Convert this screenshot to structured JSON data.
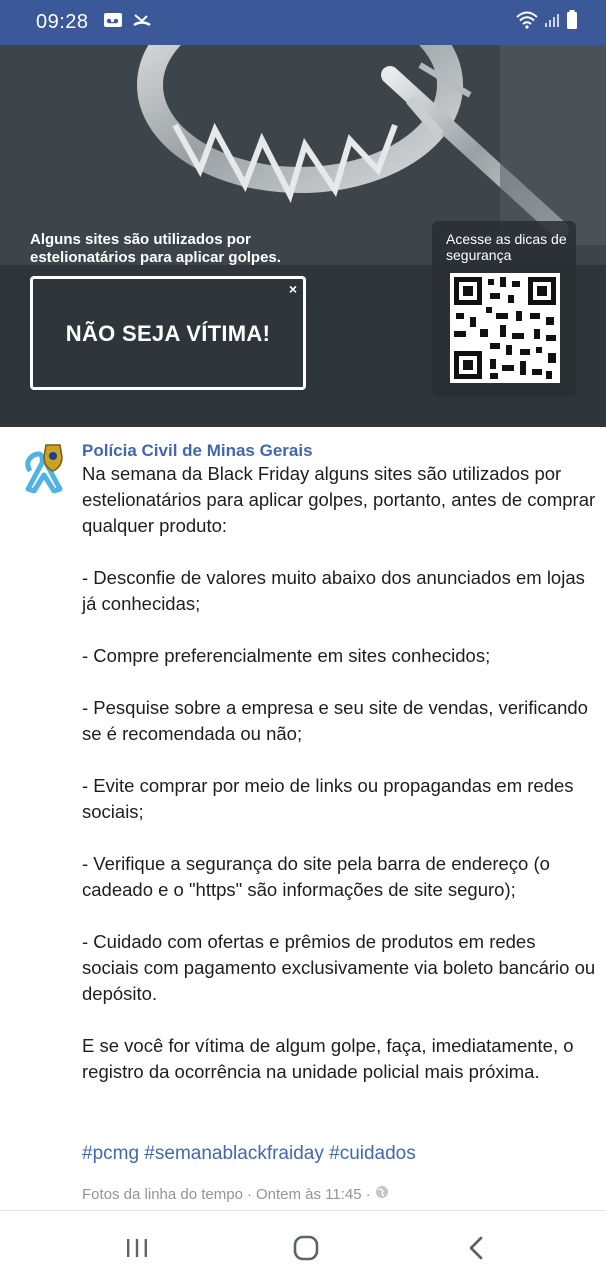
{
  "status_bar": {
    "time": "09:28",
    "icons": [
      "voicemail-icon",
      "missed-call-icon",
      "wifi-icon",
      "signal-icon",
      "battery-icon"
    ],
    "background": "#3b5998"
  },
  "banner": {
    "caption": "Alguns sites são utilizados por estelionatários para aplicar golpes.",
    "cta": "NÃO SEJA VÍTIMA!",
    "cta_close": "×",
    "qr_caption": "Acesse as dicas de segurança"
  },
  "post": {
    "author": "Polícia Civil de Minas Gerais",
    "paragraphs": [
      "Na semana da Black Friday alguns sites são utilizados por estelionatários para aplicar golpes, portanto, antes de comprar qualquer produto:",
      "- Desconfie de valores muito abaixo dos anunciados em lojas já conhecidas;",
      "- Compre preferencialmente em sites conhecidos;",
      "- Pesquise sobre a empresa e seu site de vendas, verificando se é recomendada ou não;",
      "- Evite comprar por meio de links ou propagandas em redes sociais;",
      "- Verifique a segurança do site pela barra de endereço (o cadeado e o \"https\" são informações de site seguro);",
      "- Cuidado com ofertas e prêmios de produtos em redes sociais com pagamento exclusivamente via boleto bancário ou depósito.",
      "E se você for vítima de algum golpe, faça, imediatamente, o registro da ocorrência na unidade policial mais próxima."
    ],
    "hashtags": "#pcmg #semanablackfraiday #cuidados",
    "meta_source": "Fotos da linha do tempo",
    "meta_separator": " · ",
    "meta_time": "Ontem às 11:45",
    "meta_separator2": " · ",
    "link_color": "#4267b2"
  },
  "nav_bar": {
    "buttons": [
      "recent-apps-icon",
      "home-icon",
      "back-icon"
    ]
  }
}
